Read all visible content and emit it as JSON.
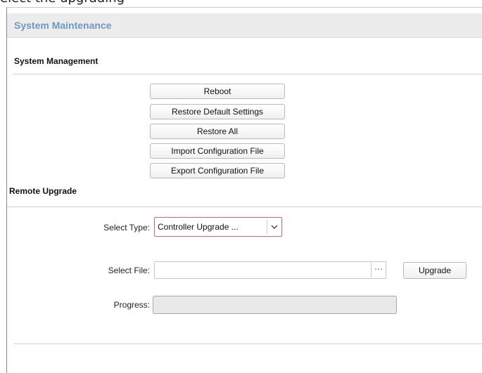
{
  "caption_fragment": "elect the upgrading",
  "panel": {
    "title": "System Maintenance"
  },
  "system_management": {
    "title": "System Management",
    "buttons": {
      "reboot": "Reboot",
      "restore_default": "Restore Default Settings",
      "restore_all": "Restore All",
      "import_config": "Import Configuration File",
      "export_config": "Export Configuration File"
    }
  },
  "remote_upgrade": {
    "title": "Remote Upgrade",
    "select_type": {
      "label": "Select Type:",
      "value": "Controller Upgrade ..."
    },
    "select_file": {
      "label": "Select File:",
      "value": "",
      "browse_label": "⋯"
    },
    "upgrade_button": "Upgrade",
    "progress": {
      "label": "Progress:",
      "value_percent": 0
    }
  },
  "colors": {
    "title_blue": "#6f97c3",
    "select_border_red": "#e06464",
    "header_bg": "#ececec"
  },
  "icons": {
    "select_arrow": "chevron-down-icon",
    "browse": "ellipsis-icon"
  }
}
